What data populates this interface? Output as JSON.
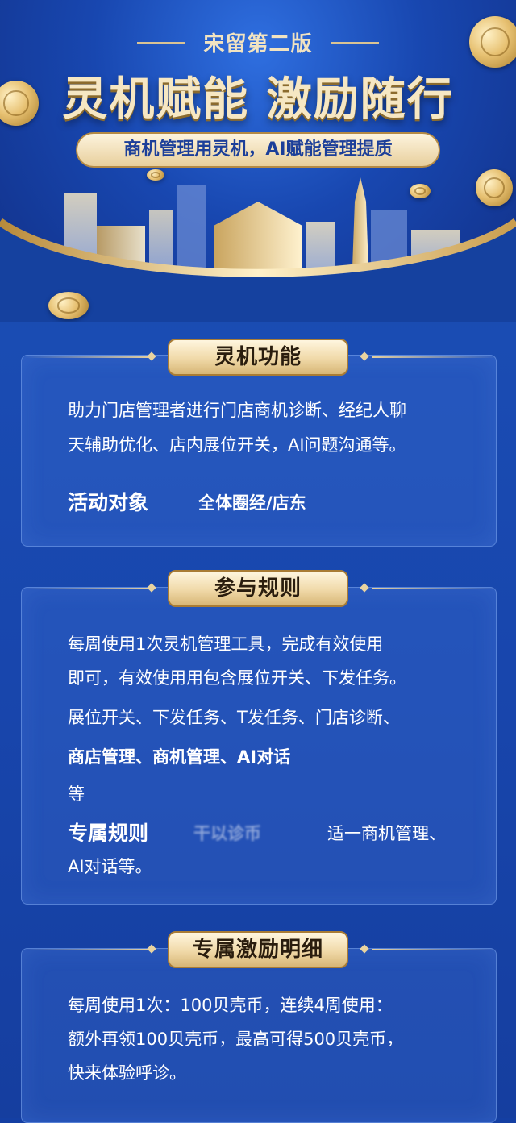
{
  "hero": {
    "edition": "宋留第二版",
    "title": "灵机赋能 激励随行",
    "subtitle": "商机管理用灵机，AI赋能管理提质"
  },
  "sections": {
    "features": {
      "heading": "灵机功能",
      "body": [
        "助力门店管理者进行门店商机诊断、经纪人聊",
        "天辅助优化、店内展位开关，AI问题沟通等。"
      ],
      "target_label": "活动对象",
      "target_value": "全体圈经/店东"
    },
    "rules": {
      "heading": "参与规则",
      "body": [
        "每周使用1次灵机管理工具，完成有效使用",
        "即可，有效使用用包含展位开关、下发任务。",
        "展位开关、下发任务、T发任务、门店诊断、",
        "商店管理、商机管理、AI对话",
        "等"
      ],
      "exclusive_label": "专属规则",
      "exclusive_blur": "干以诊币",
      "exclusive_value": "适一商机管理、",
      "exclusive_tail": "AI对话等。"
    },
    "rewards": {
      "heading": "专属激励明细",
      "body": [
        "每周使用1次：100贝壳币，连续4周使用：",
        "额外再领100贝壳币，最高可得500贝壳币，",
        "快来体验呼诊。"
      ]
    }
  },
  "colors": {
    "gold": "#f0d9a8",
    "deep_blue": "#143fa3",
    "text": "#ffffff"
  }
}
